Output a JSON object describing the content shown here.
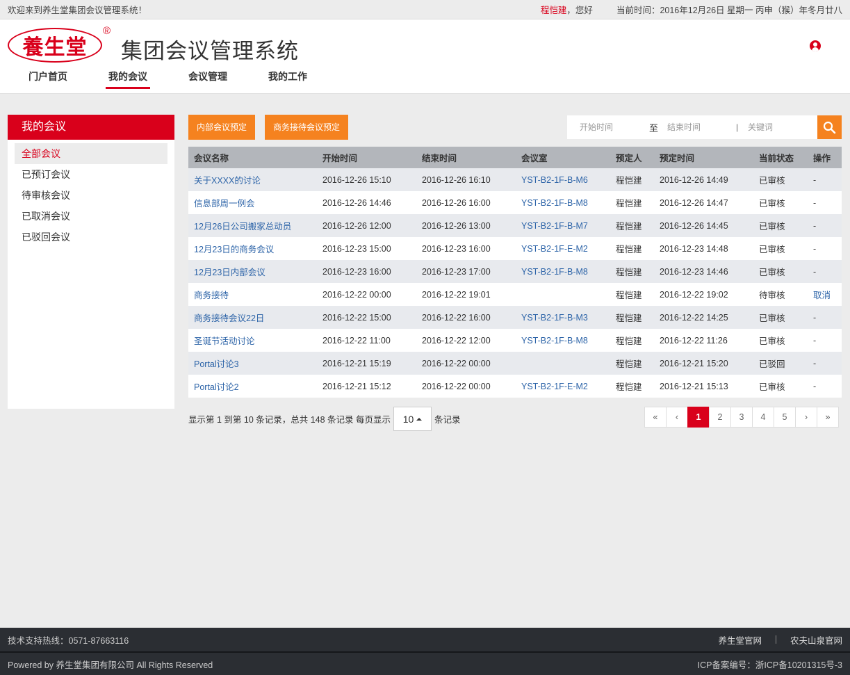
{
  "topbar": {
    "welcome": "欢迎来到养生堂集团会议管理系统！",
    "username": "程恺建",
    "greeting": "，您好",
    "date_text": "当前时间：2016年12月26日   星期一   丙申（猴）年冬月廿八"
  },
  "header": {
    "logo_text": "養生堂",
    "logo_reg": "®",
    "system_title": "集团会议管理系统",
    "nav": [
      {
        "label": "门户首页",
        "active": false
      },
      {
        "label": "我的会议",
        "active": true
      },
      {
        "label": "会议管理",
        "active": false
      },
      {
        "label": "我的工作",
        "active": false
      }
    ]
  },
  "sidebar": {
    "title": "我的会议",
    "items": [
      {
        "label": "全部会议",
        "active": true
      },
      {
        "label": "已预订会议",
        "active": false
      },
      {
        "label": "待审核会议",
        "active": false
      },
      {
        "label": "已取消会议",
        "active": false
      },
      {
        "label": "已驳回会议",
        "active": false
      }
    ]
  },
  "actions": {
    "internal_booking": "内部会议预定",
    "business_booking": "商务接待会议预定"
  },
  "search": {
    "start_placeholder": "开始时间",
    "to_label": "至",
    "end_placeholder": "结束时间",
    "separator": "|",
    "keyword_placeholder": "关键词"
  },
  "table": {
    "columns": [
      "会议名称",
      "开始时间",
      "结束时间",
      "会议室",
      "预定人",
      "预定时间",
      "当前状态",
      "操作"
    ],
    "rows": [
      {
        "name": "关于XXXX的讨论",
        "start": "2016-12-26 15:10",
        "end": "2016-12-26 16:10",
        "room": "YST-B2-1F-B-M6",
        "booker": "程恺建",
        "booked_at": "2016-12-26 14:49",
        "status": "已审核",
        "op": "-"
      },
      {
        "name": "信息部周一例会",
        "start": "2016-12-26 14:46",
        "end": "2016-12-26 16:00",
        "room": "YST-B2-1F-B-M8",
        "booker": "程恺建",
        "booked_at": "2016-12-26 14:47",
        "status": "已审核",
        "op": "-"
      },
      {
        "name": "12月26日公司搬家总动员",
        "start": "2016-12-26 12:00",
        "end": "2016-12-26 13:00",
        "room": "YST-B2-1F-B-M7",
        "booker": "程恺建",
        "booked_at": "2016-12-26 14:45",
        "status": "已审核",
        "op": "-"
      },
      {
        "name": "12月23日的商务会议",
        "start": "2016-12-23 15:00",
        "end": "2016-12-23 16:00",
        "room": "YST-B2-1F-E-M2",
        "booker": "程恺建",
        "booked_at": "2016-12-23 14:48",
        "status": "已审核",
        "op": "-"
      },
      {
        "name": "12月23日内部会议",
        "start": "2016-12-23 16:00",
        "end": "2016-12-23 17:00",
        "room": "YST-B2-1F-B-M8",
        "booker": "程恺建",
        "booked_at": "2016-12-23 14:46",
        "status": "已审核",
        "op": "-"
      },
      {
        "name": "商务接待",
        "start": "2016-12-22 00:00",
        "end": "2016-12-22 19:01",
        "room": "",
        "booker": "程恺建",
        "booked_at": "2016-12-22 19:02",
        "status": "待审核",
        "op": "取消"
      },
      {
        "name": "商务接待会议22日",
        "start": "2016-12-22 15:00",
        "end": "2016-12-22 16:00",
        "room": "YST-B2-1F-B-M3",
        "booker": "程恺建",
        "booked_at": "2016-12-22 14:25",
        "status": "已审核",
        "op": "-"
      },
      {
        "name": "圣诞节活动讨论",
        "start": "2016-12-22 11:00",
        "end": "2016-12-22 12:00",
        "room": "YST-B2-1F-B-M8",
        "booker": "程恺建",
        "booked_at": "2016-12-22 11:26",
        "status": "已审核",
        "op": "-"
      },
      {
        "name": "Portal讨论3",
        "start": "2016-12-21 15:19",
        "end": "2016-12-22 00:00",
        "room": "",
        "booker": "程恺建",
        "booked_at": "2016-12-21 15:20",
        "status": "已驳回",
        "op": "-"
      },
      {
        "name": "Portal讨论2",
        "start": "2016-12-21 15:12",
        "end": "2016-12-22 00:00",
        "room": "YST-B2-1F-E-M2",
        "booker": "程恺建",
        "booked_at": "2016-12-21 15:13",
        "status": "已审核",
        "op": "-"
      }
    ]
  },
  "pagination": {
    "info": "显示第 1 到第 10 条记录，总共 148 条记录 每页显示",
    "page_size": "10",
    "suffix": "条记录",
    "buttons": [
      "«",
      "‹",
      "1",
      "2",
      "3",
      "4",
      "5",
      "›",
      "»"
    ],
    "current": "1"
  },
  "footer": {
    "hotline": "技术支持热线：0571-87663116",
    "links": [
      "养生堂官网",
      "农夫山泉官网"
    ],
    "copyright": "Powered by 养生堂集团有限公司 All Rights Reserved",
    "icp": "ICP备案编号：浙ICP备10201315号-3"
  },
  "colors": {
    "brand_red": "#d9001b",
    "accent_orange": "#f5821f",
    "link_blue": "#2d64a8",
    "footer_bg": "#2b2e33"
  }
}
